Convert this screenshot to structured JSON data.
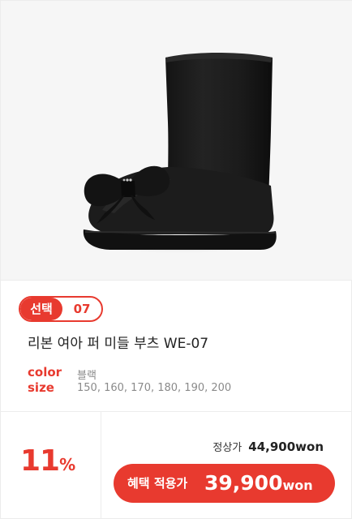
{
  "badge": {
    "label": "선택",
    "number": "07"
  },
  "product": {
    "name": "리본 여아 퍼 미들 부츠 WE-07",
    "specs": [
      {
        "key": "color",
        "value": "블랙"
      },
      {
        "key": "size",
        "value": "150, 160, 170, 180, 190, 200"
      }
    ]
  },
  "pricing": {
    "discount_number": "11",
    "discount_unit": "%",
    "regular_label": "정상가",
    "regular_price": "44,900",
    "regular_currency": "won",
    "benefit_label": "혜택 적용가",
    "benefit_price": "39,900",
    "benefit_currency": "won"
  },
  "colors": {
    "accent": "#e83a2f",
    "boot": "#1a1a1a",
    "background": "#f6f6f6"
  }
}
